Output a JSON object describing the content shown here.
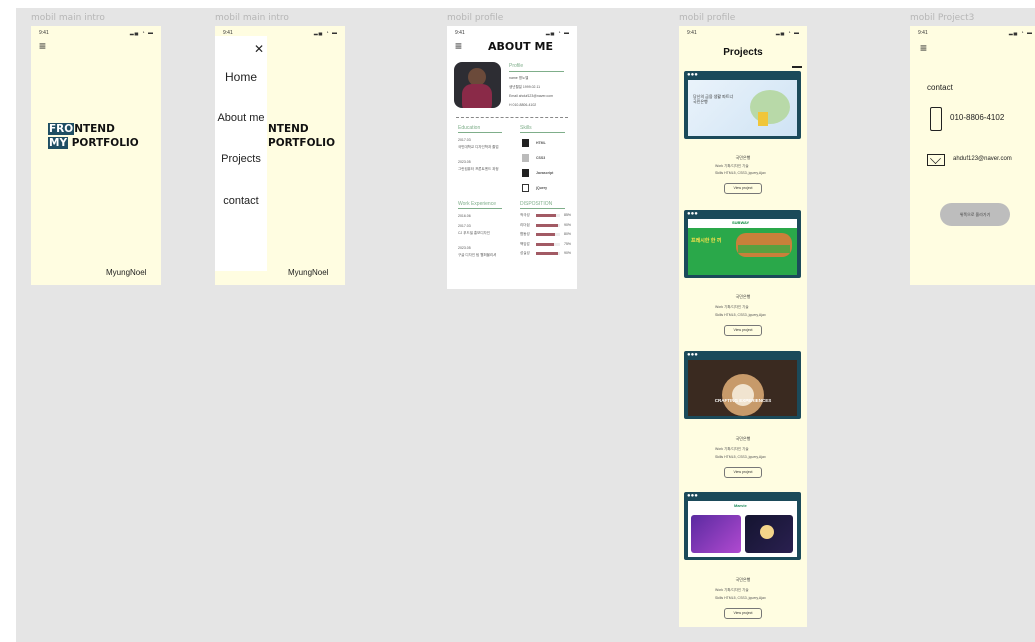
{
  "frames": {
    "intro1": {
      "label": "mobil main intro",
      "time": "9:41",
      "logo_line1_hl": "FRO",
      "logo_line1_rest": "NTEND",
      "logo_line2_hl": "MY",
      "logo_line2_rest": " PORTFOLIO",
      "signature": "MyungNoel"
    },
    "intro2": {
      "label": "mobil main intro",
      "time": "9:41",
      "close": "✕",
      "nav": [
        "Home",
        "About me",
        "Projects",
        "contact"
      ],
      "logo_line1": "NTEND",
      "logo_line2": "PORTFOLIO",
      "signature": "MyungNoel"
    },
    "profile": {
      "label": "mobil profile",
      "time": "9:41",
      "title": "ABOUT ME",
      "profile_heading": "Profile",
      "profile_rows": [
        "name  명노엘",
        "생년월일  1999.02.11",
        "Email  ahduf123@naver.com",
        "H  010-8806-4102"
      ],
      "education_heading": "Education",
      "education": [
        "2017.03",
        "국민대학교 디자인학과 졸업",
        "2023.05",
        "그린컴퓨터 프론트엔드 과정"
      ],
      "skills_heading": "Skills",
      "skills": [
        "HTML",
        "CSS3",
        "Javascript",
        "jQuery"
      ],
      "work_heading": "Work Experience",
      "work": [
        "2016.06",
        "2017.03",
        "CJ 푸드빌 홍보디자인",
        "2023.05",
        "구글 디자인 팀 웹퍼블리셔"
      ],
      "disposition_heading": "DISPOSITION",
      "disposition": [
        {
          "name": "적극성",
          "value": 0.85,
          "pct": "85%"
        },
        {
          "name": "리더쉽",
          "value": 0.9,
          "pct": "90%"
        },
        {
          "name": "협동성",
          "value": 0.8,
          "pct": "80%"
        },
        {
          "name": "책임감",
          "value": 0.75,
          "pct": "75%"
        },
        {
          "name": "성실성",
          "value": 0.9,
          "pct": "90%"
        }
      ]
    },
    "projects": {
      "label": "mobil profile",
      "time": "9:41",
      "title": "Projects",
      "items": [
        {
          "name": "국민은행",
          "work": "Work  기획/디자인 기술",
          "skills": "Skills  HTML5, CSS3, jquery,Ajax",
          "button": "View project"
        },
        {
          "name": "국민은행",
          "work": "Work  기획/디자인 기술",
          "skills": "Skills  HTML5, CSS3, jquery,Ajax",
          "button": "View project"
        },
        {
          "name": "국민은행",
          "work": "Work  기획/디자인 기술",
          "skills": "Skills  HTML5, CSS3, jquery,Ajax",
          "button": "View project"
        },
        {
          "name": "국민은행",
          "work": "Work  기획/디자인 기술",
          "skills": "Skills  HTML5, CSS3, jquery,Ajax",
          "button": "View project"
        }
      ],
      "shot1_text": "당신의 금융 생활 파트너\n국민은행",
      "shot2_brand": "SUBWAY",
      "shot2_text": "프레시한 한 끼",
      "shot3_text": "CRAFTING EXPERIENCES",
      "shot4_brand": "Marvie"
    },
    "contact": {
      "label": "mobil Project3",
      "time": "9:41",
      "heading": "contact",
      "phone": "010-8806-4102",
      "email": "ahduf123@naver.com",
      "button": "위쪽으로 올라가기"
    }
  },
  "colors": {
    "canvas": "#e5e5e5",
    "frame_bg": "#fffde1",
    "logo_accent": "#1f4e63",
    "card_bg": "#1b4a5a",
    "green": "#7fae8a",
    "bar": "#a25a64"
  }
}
